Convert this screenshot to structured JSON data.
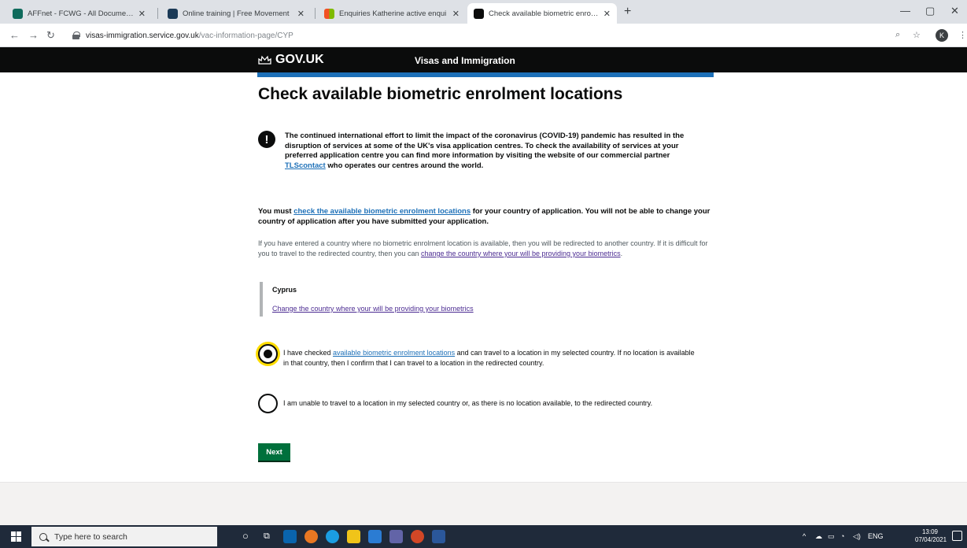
{
  "browser": {
    "tabs": [
      {
        "label": "AFFnet - FCWG - All Documents",
        "favicon_color": "#0f6b5c"
      },
      {
        "label": "Online training | Free Movement",
        "favicon_color": "#1b3a57"
      },
      {
        "label": "Enquiries Katherine active enqui",
        "favicon_color": "#e8a11c"
      },
      {
        "label": "Check available biometric enrolm",
        "favicon_color": "#0b0c0c"
      }
    ],
    "url_host": "visas-immigration.service.gov.uk",
    "url_path": "/vac-information-page/CYP",
    "profile_initial": "K"
  },
  "header": {
    "logo_text": "GOV.UK",
    "service_name": "Visas and Immigration"
  },
  "page": {
    "title": "Check available biometric enrolment locations",
    "warning": {
      "text_before": "The continued international effort to limit the impact of the coronavirus (COVID-19) pandemic has resulted in the disruption of services at some of the UK's visa application centres. To check the availability of services at your preferred application centre you can find more information by visiting the website of our commercial partner ",
      "link": "TLScontact",
      "text_after": " who operates our centres around the world."
    },
    "p1": {
      "before": "You must ",
      "link": "check the available biometric enrolment locations",
      "after": " for your country of application. You will not be able to change your country of application after you have submitted your application."
    },
    "p2": {
      "before": "If you have entered a country where no biometric enrolment location is available, then you will be redirected to another country. If it is difficult for you to travel to the redirected country, then you can ",
      "link": "change the country where your will be providing your biometrics",
      "after": "."
    },
    "inset": {
      "country": "Cyprus",
      "change_link": "Change the country where your will be providing your biometrics"
    },
    "options": [
      {
        "before": "I have checked ",
        "link": "available biometric enrolment locations",
        "after": " and can travel to a location in my selected country. If no location is available in that country, then I confirm that I can travel to a location in the redirected country.",
        "checked": true
      },
      {
        "before": "I am unable to travel to a location in my selected country or, as there is no location available, to the redirected country.",
        "link": "",
        "after": "",
        "checked": false
      }
    ],
    "next_button": "Next"
  },
  "taskbar": {
    "search_placeholder": "Type here to search",
    "tray_lang": "ENG",
    "time": "13:09",
    "date": "07/04/2021"
  },
  "colors": {
    "govuk_blue": "#1d70b8",
    "button_green": "#00703c",
    "focus_yellow": "#ffdd00"
  }
}
